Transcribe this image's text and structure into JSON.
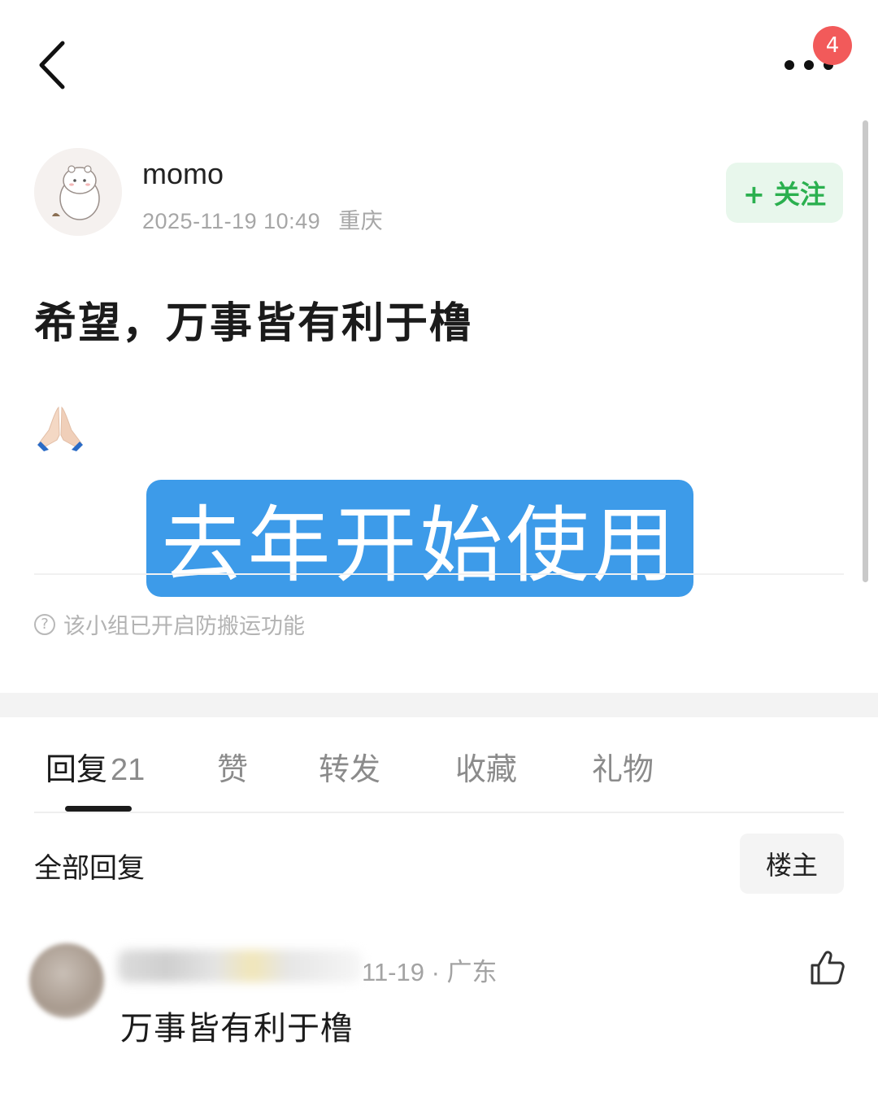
{
  "header": {
    "back_icon": "chevron-left-icon",
    "more_icon": "more-dots-icon",
    "notification_count": "4"
  },
  "post": {
    "author": "momo",
    "timestamp": "2025-11-19 10:49",
    "location": "重庆",
    "follow_label": "+ 关注",
    "title": "希望，万事皆有利于橹",
    "emoji": "🙏",
    "overlay_caption": "去年开始使用",
    "notice": "该小组已开启防搬运功能"
  },
  "tabs": [
    {
      "label": "回复",
      "count": "21",
      "active": true
    },
    {
      "label": "赞"
    },
    {
      "label": "转发"
    },
    {
      "label": "收藏"
    },
    {
      "label": "礼物"
    }
  ],
  "replies": {
    "title": "全部回复",
    "filter_label": "楼主"
  },
  "comment": {
    "meta": "11-19 · 广东",
    "text": "万事皆有利于橹"
  },
  "colors": {
    "accent_green": "#2bb04f",
    "caption_blue": "#3d9be9",
    "badge_red": "#f25a5a"
  }
}
